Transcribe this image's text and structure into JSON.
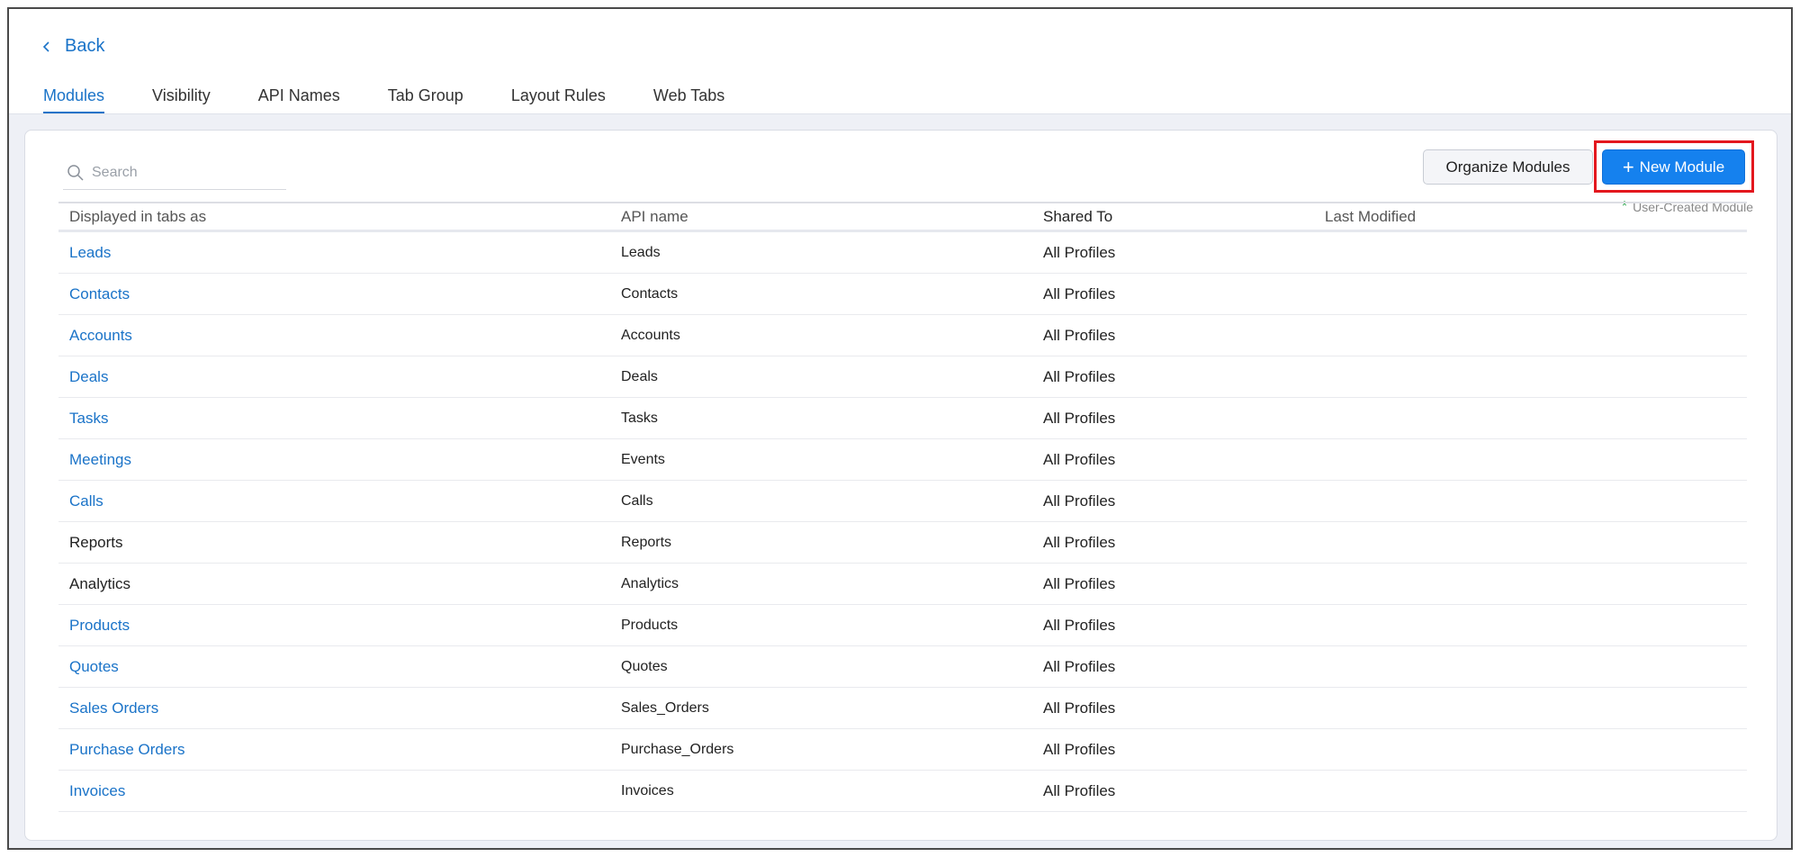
{
  "back_label": "Back",
  "tabs": [
    {
      "label": "Modules",
      "active": true
    },
    {
      "label": "Visibility",
      "active": false
    },
    {
      "label": "API Names",
      "active": false
    },
    {
      "label": "Tab Group",
      "active": false
    },
    {
      "label": "Layout Rules",
      "active": false
    },
    {
      "label": "Web Tabs",
      "active": false
    }
  ],
  "search": {
    "placeholder": "Search",
    "value": ""
  },
  "toolbar": {
    "organize_label": "Organize Modules",
    "new_module_label": "New Module",
    "user_created_note": "User-Created Module"
  },
  "table": {
    "headers": [
      "Displayed in tabs as",
      "API name",
      "Shared To",
      "Last Modified"
    ],
    "rows": [
      {
        "display": "Leads",
        "api": "Leads",
        "shared": "All Profiles",
        "modified": "",
        "link": true
      },
      {
        "display": "Contacts",
        "api": "Contacts",
        "shared": "All Profiles",
        "modified": "",
        "link": true
      },
      {
        "display": "Accounts",
        "api": "Accounts",
        "shared": "All Profiles",
        "modified": "",
        "link": true
      },
      {
        "display": "Deals",
        "api": "Deals",
        "shared": "All Profiles",
        "modified": "",
        "link": true
      },
      {
        "display": "Tasks",
        "api": "Tasks",
        "shared": "All Profiles",
        "modified": "",
        "link": true
      },
      {
        "display": "Meetings",
        "api": "Events",
        "shared": "All Profiles",
        "modified": "",
        "link": true
      },
      {
        "display": "Calls",
        "api": "Calls",
        "shared": "All Profiles",
        "modified": "",
        "link": true
      },
      {
        "display": "Reports",
        "api": "Reports",
        "shared": "All Profiles",
        "modified": "",
        "link": false
      },
      {
        "display": "Analytics",
        "api": "Analytics",
        "shared": "All Profiles",
        "modified": "",
        "link": false
      },
      {
        "display": "Products",
        "api": "Products",
        "shared": "All Profiles",
        "modified": "",
        "link": true
      },
      {
        "display": "Quotes",
        "api": "Quotes",
        "shared": "All Profiles",
        "modified": "",
        "link": true
      },
      {
        "display": "Sales Orders",
        "api": "Sales_Orders",
        "shared": "All Profiles",
        "modified": "",
        "link": true
      },
      {
        "display": "Purchase Orders",
        "api": "Purchase_Orders",
        "shared": "All Profiles",
        "modified": "",
        "link": true
      },
      {
        "display": "Invoices",
        "api": "Invoices",
        "shared": "All Profiles",
        "modified": "",
        "link": true
      }
    ]
  },
  "colors": {
    "accent": "#1a73c8",
    "primary_button": "#1581ee",
    "highlight": "#e3171e",
    "user_created_star": "#2fa84f"
  }
}
